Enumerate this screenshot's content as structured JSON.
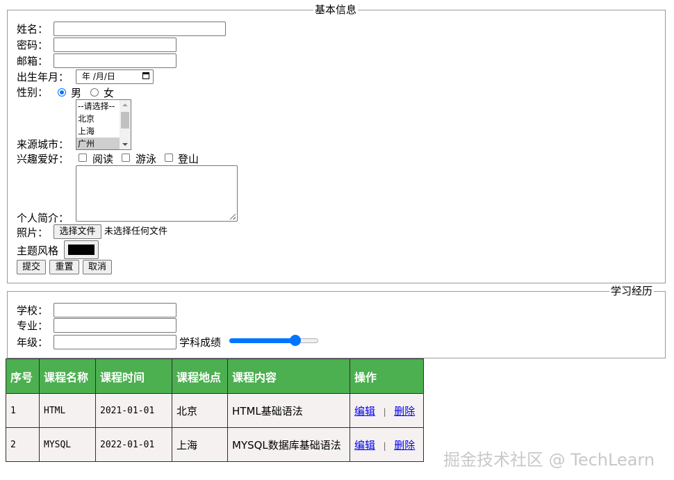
{
  "basic_info": {
    "legend": "基本信息",
    "name_label": "姓名：",
    "password_label": "密码：",
    "email_label": "邮箱：",
    "birth_label": "出生年月：",
    "birth_placeholder": "年 /月/日",
    "gender_label": "性别：",
    "gender_options": [
      "男",
      "女"
    ],
    "gender_selected": "男",
    "city_label": "来源城市：",
    "city_options": [
      "--请选择--",
      "北京",
      "上海",
      "广州"
    ],
    "city_selected": "广州",
    "hobby_label": "兴趣爱好：",
    "hobbies": [
      "阅读",
      "游泳",
      "登山"
    ],
    "intro_label": "个人简介：",
    "photo_label": "照片：",
    "file_button": "选择文件",
    "file_status": "未选择任何文件",
    "theme_label": "主题风格",
    "theme_color": "#000000",
    "buttons": {
      "submit": "提交",
      "reset": "重置",
      "cancel": "取消"
    }
  },
  "study": {
    "legend": "学习经历",
    "school_label": "学校：",
    "major_label": "专业：",
    "grade_label": "年级：",
    "score_label": "学科成绩",
    "score_value": 0.78
  },
  "table": {
    "headers": [
      "序号",
      "课程名称",
      "课程时间",
      "课程地点",
      "课程内容",
      "操作"
    ],
    "rows": [
      {
        "id": "1",
        "name": "HTML",
        "time": "2021-01-01",
        "place": "北京",
        "content": "HTML基础语法",
        "edit": "编辑",
        "sep": "|",
        "delete": "删除"
      },
      {
        "id": "2",
        "name": "MYSQL",
        "time": "2022-01-01",
        "place": "上海",
        "content": "MYSQL数据库基础语法",
        "edit": "编辑",
        "sep": "|",
        "delete": "删除"
      }
    ],
    "header_color": "#4caf50"
  },
  "watermark": "掘金技术社区 @ TechLearn"
}
